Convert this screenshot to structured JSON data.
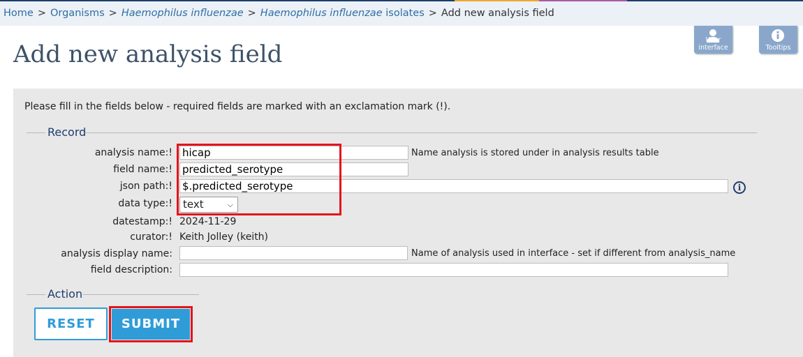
{
  "breadcrumb": {
    "home": "Home",
    "organisms": "Organisms",
    "organism": "Haemophilus influenzae",
    "isolates_italic": "Haemophilus influenzae",
    "isolates_suffix": " isolates",
    "current": "Add new analysis field",
    "separator": ">"
  },
  "toolbar": {
    "user_interface": "User interface",
    "tooltips": "Tooltips"
  },
  "page_title": "Add new analysis field",
  "intro_text": "Please fill in the fields below - required fields are marked with an exclamation mark (!).",
  "record": {
    "legend": "Record",
    "fields": {
      "analysis_name": {
        "label": "analysis name:!",
        "value": "hicap",
        "hint": "Name analysis is stored under in analysis results table"
      },
      "field_name": {
        "label": "field name:!",
        "value": "predicted_serotype"
      },
      "json_path": {
        "label": "json path:!",
        "value": "$.predicted_serotype"
      },
      "data_type": {
        "label": "data type:!",
        "value": "text"
      },
      "datestamp": {
        "label": "datestamp:!",
        "value": "2024-11-29"
      },
      "curator": {
        "label": "curator:!",
        "value": "Keith Jolley (keith)"
      },
      "analysis_display_name": {
        "label": "analysis display name:",
        "value": "",
        "hint": "Name of analysis used in interface - set if different from analysis_name"
      },
      "field_description": {
        "label": "field description:",
        "value": ""
      }
    }
  },
  "action": {
    "legend": "Action",
    "reset": "RESET",
    "submit": "SUBMIT"
  },
  "icons": {
    "user": "user-icon",
    "tooltips": "info-icon",
    "json_path_help": "info-icon"
  },
  "colors": {
    "accent": "#2f9cd8",
    "highlight": "#e4141b",
    "legend_text": "#1e3d6d"
  }
}
